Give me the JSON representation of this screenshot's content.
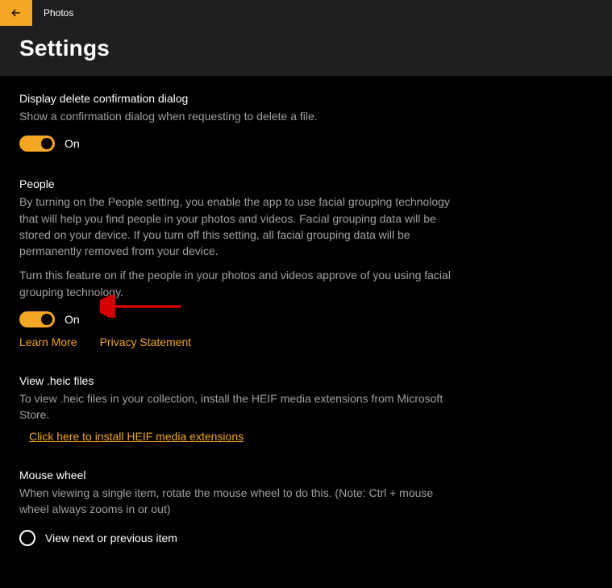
{
  "titlebar": {
    "app_name": "Photos"
  },
  "header": {
    "title": "Settings"
  },
  "sections": {
    "delete_confirm": {
      "title": "Display delete confirmation dialog",
      "desc": "Show a confirmation dialog when requesting to delete a file.",
      "state": "On"
    },
    "people": {
      "title": "People",
      "desc1": "By turning on the People setting, you enable the app to use facial grouping technology that will help you find people in your photos and videos. Facial grouping data will be stored on your device. If you turn off this setting, all facial grouping data will be permanently removed from your device.",
      "desc2": "Turn this feature on if the people in your photos and videos approve of you using facial grouping technology.",
      "state": "On",
      "learn_more": "Learn More",
      "privacy": "Privacy Statement"
    },
    "heic": {
      "title": "View .heic files",
      "desc": "To view .heic files in your collection, install the HEIF media extensions from Microsoft Store.",
      "link": "Click here to install HEIF media extensions"
    },
    "mouse": {
      "title": "Mouse wheel",
      "desc": "When viewing a single item, rotate the mouse wheel to do this. (Note: Ctrl + mouse wheel always zooms in or out)",
      "option1": "View next or previous item"
    }
  }
}
